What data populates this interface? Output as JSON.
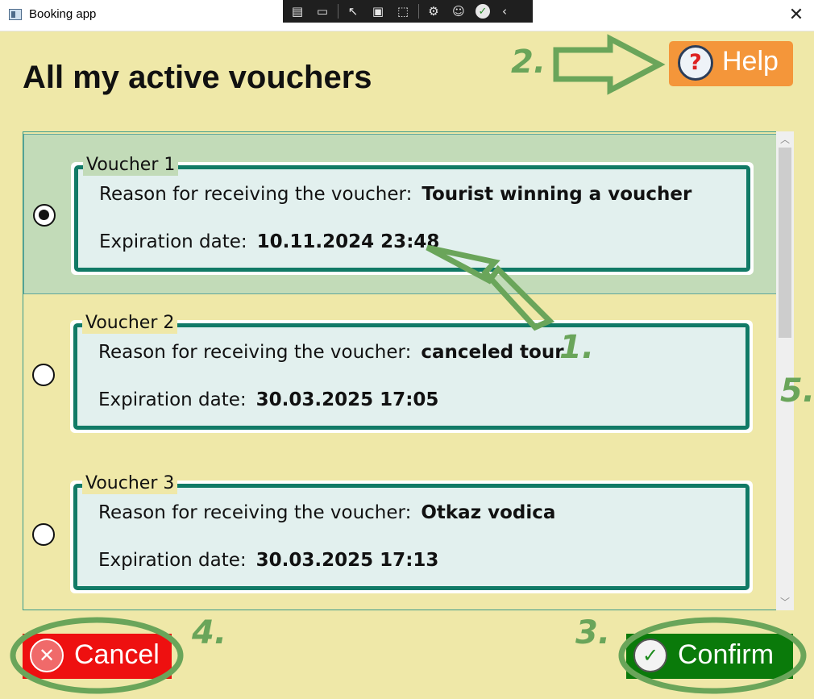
{
  "window": {
    "title": "Booking app",
    "close_glyph": "✕"
  },
  "devtools": {
    "icons": [
      "live-tree-icon",
      "record-icon",
      "select-element-icon",
      "display-layout-icon",
      "track-focus-icon",
      "binding-icon",
      "accessibility-icon",
      "hot-reload-check-icon",
      "collapse-chevron-icon"
    ]
  },
  "header": {
    "title": "All my active vouchers"
  },
  "help": {
    "label": "Help",
    "icon": "?"
  },
  "annotations": {
    "a1": "1.",
    "a2": "2.",
    "a3": "3.",
    "a4": "4.",
    "a5": "5."
  },
  "vouchers": [
    {
      "legend": "Voucher 1",
      "reason_label": "Reason for receiving the voucher:",
      "reason": "Tourist winning a voucher",
      "exp_label": "Expiration date:",
      "expiration": "10.11.2024 23:48",
      "selected": true
    },
    {
      "legend": "Voucher 2",
      "reason_label": "Reason for receiving the voucher:",
      "reason": "canceled tour",
      "exp_label": "Expiration date:",
      "expiration": "30.03.2025 17:05",
      "selected": false
    },
    {
      "legend": "Voucher 3",
      "reason_label": "Reason for receiving the voucher:",
      "reason": "Otkaz vodica",
      "exp_label": "Expiration date:",
      "expiration": "30.03.2025 17:13",
      "selected": false
    }
  ],
  "footer": {
    "cancel_label": "Cancel",
    "cancel_icon": "✕",
    "confirm_label": "Confirm",
    "confirm_icon": "✓"
  },
  "colors": {
    "background": "#efe8a8",
    "accent": "#117a66",
    "cancel": "#ee1010",
    "confirm": "#0a7a0a",
    "help": "#f4963a",
    "annotation": "#6aa55a"
  }
}
